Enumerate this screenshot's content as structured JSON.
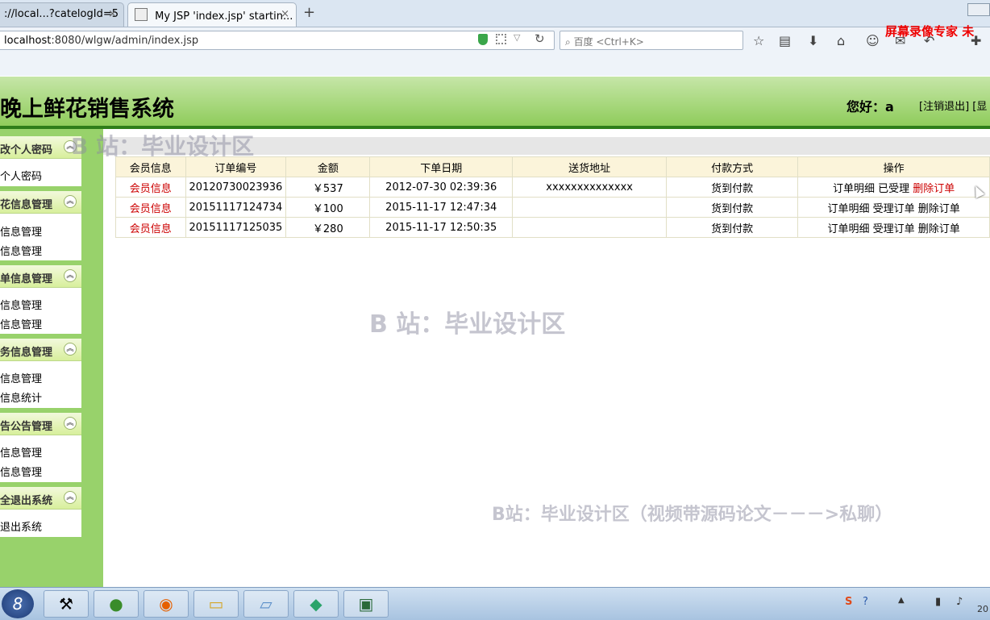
{
  "browser": {
    "tab1_title": "://local...?catelogId=5",
    "tab2_title": "My JSP 'index.jsp' startin...",
    "close_glyph": "×",
    "new_tab_glyph": "+",
    "url_host": "localhost",
    "url_rest": ":8080/wlgw/admin/index.jsp",
    "search_placeholder": "百度 <Ctrl+K>",
    "recorder_text": "屏幕录像专家 未"
  },
  "app": {
    "title": "晚上鲜花销售系统",
    "greeting": "您好：a",
    "logout_link": "[注销退出] [显"
  },
  "sidebar": {
    "sections": [
      {
        "title": "改个人密码",
        "items": [
          "个人密码"
        ]
      },
      {
        "title": "花信息管理",
        "items": [
          "信息管理",
          "信息管理"
        ]
      },
      {
        "title": "单信息管理",
        "items": [
          "信息管理",
          "信息管理"
        ]
      },
      {
        "title": "务信息管理",
        "items": [
          "信息管理",
          "信息统计"
        ]
      },
      {
        "title": "告公告管理",
        "items": [
          "信息管理",
          "信息管理"
        ]
      },
      {
        "title": "全退出系统",
        "items": [
          "退出系统"
        ]
      }
    ]
  },
  "table": {
    "headers": [
      "会员信息",
      "订单编号",
      "金额",
      "下单日期",
      "送货地址",
      "付款方式",
      "操作"
    ],
    "rows": [
      {
        "member": "会员信息",
        "order_no": "20120730023936",
        "amount": "￥537",
        "date": "2012-07-30 02:39:36",
        "address": "xxxxxxxxxxxxxx",
        "payment": "货到付款",
        "op1": "订单明细",
        "op2": "已受理",
        "op3": "删除订单"
      },
      {
        "member": "会员信息",
        "order_no": "20151117124734",
        "amount": "￥100",
        "date": "2015-11-17 12:47:34",
        "address": "",
        "payment": "货到付款",
        "op1": "订单明细",
        "op2": "受理订单",
        "op3": "删除订单"
      },
      {
        "member": "会员信息",
        "order_no": "20151117125035",
        "amount": "￥280",
        "date": "2015-11-17 12:50:35",
        "address": "",
        "payment": "货到付款",
        "op1": "订单明细",
        "op2": "受理订单",
        "op3": "删除订单"
      }
    ]
  },
  "watermarks": {
    "wm1": "B 站：毕业设计区",
    "wm2": "B 站：毕业设计区",
    "wm3": "B站：毕业设计区（视频带源码论文－－－>私聊）"
  },
  "taskbar": {
    "clock": "20"
  },
  "colors": {
    "header_green": "#8fcc5b",
    "sidebar_green": "#98d26b",
    "link_red": "#cc0000"
  }
}
